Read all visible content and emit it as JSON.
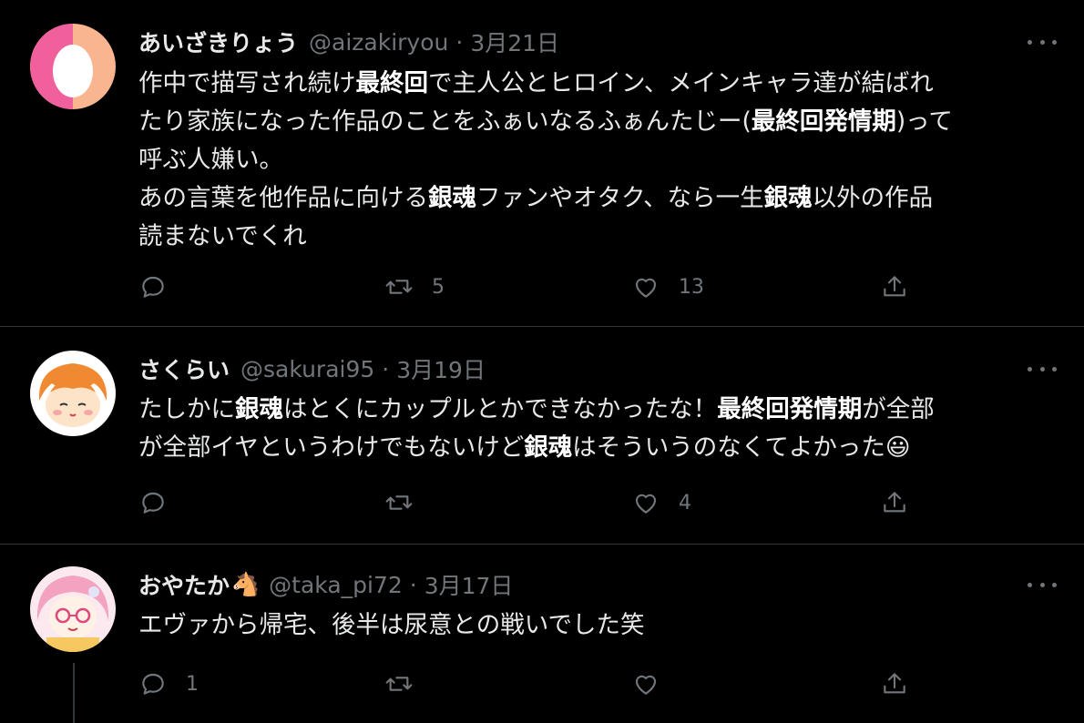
{
  "tweets": [
    {
      "name": "あいざきりょう",
      "handle": "@aizakiryou",
      "date": "3月21日",
      "lines": [
        [
          {
            "t": "作中で描写され続け"
          },
          {
            "t": "最終回",
            "b": true
          },
          {
            "t": "で主人公とヒロイン、メインキャラ達が結ばれ"
          }
        ],
        [
          {
            "t": "たり家族になった作品のことをふぁいなるふぁんたじー("
          },
          {
            "t": "最終回発情期",
            "b": true
          },
          {
            "t": ")って"
          }
        ],
        [
          {
            "t": "呼ぶ人嫌い。"
          }
        ],
        [
          {
            "t": "あの言葉を他作品に向ける"
          },
          {
            "t": "銀魂",
            "b": true
          },
          {
            "t": "ファンやオタク、なら一生"
          },
          {
            "t": "銀魂",
            "b": true
          },
          {
            "t": "以外の作品"
          }
        ],
        [
          {
            "t": "読まないでくれ"
          }
        ]
      ],
      "replies": "",
      "retweets": "5",
      "likes": "13"
    },
    {
      "name": "さくらい",
      "handle": "@sakurai95",
      "date": "3月19日",
      "lines": [
        [
          {
            "t": "たしかに"
          },
          {
            "t": "銀魂",
            "b": true
          },
          {
            "t": "はとくにカップルとかできなかったな！"
          },
          {
            "t": "最終回発情期",
            "b": true
          },
          {
            "t": "が全部"
          }
        ],
        [
          {
            "t": "が全部イヤというわけでもないけど"
          },
          {
            "t": "銀魂",
            "b": true
          },
          {
            "t": "はそういうのなくてよかった😃"
          }
        ]
      ],
      "replies": "",
      "retweets": "",
      "likes": "4"
    },
    {
      "name": "おやたか",
      "name_emoji": "🐴",
      "handle": "@taka_pi72",
      "date": "3月17日",
      "lines": [
        [
          {
            "t": "エヴァから帰宅、後半は尿意との戦いでした笑"
          }
        ]
      ],
      "replies": "1",
      "retweets": "",
      "likes": ""
    }
  ],
  "icons": {
    "reply": "reply-icon",
    "retweet": "retweet-icon",
    "like": "heart-icon",
    "share": "share-icon",
    "more": "more-icon"
  },
  "colors": {
    "background": "#000000",
    "secondary_text": "#71767b",
    "divider": "#2f3336"
  }
}
